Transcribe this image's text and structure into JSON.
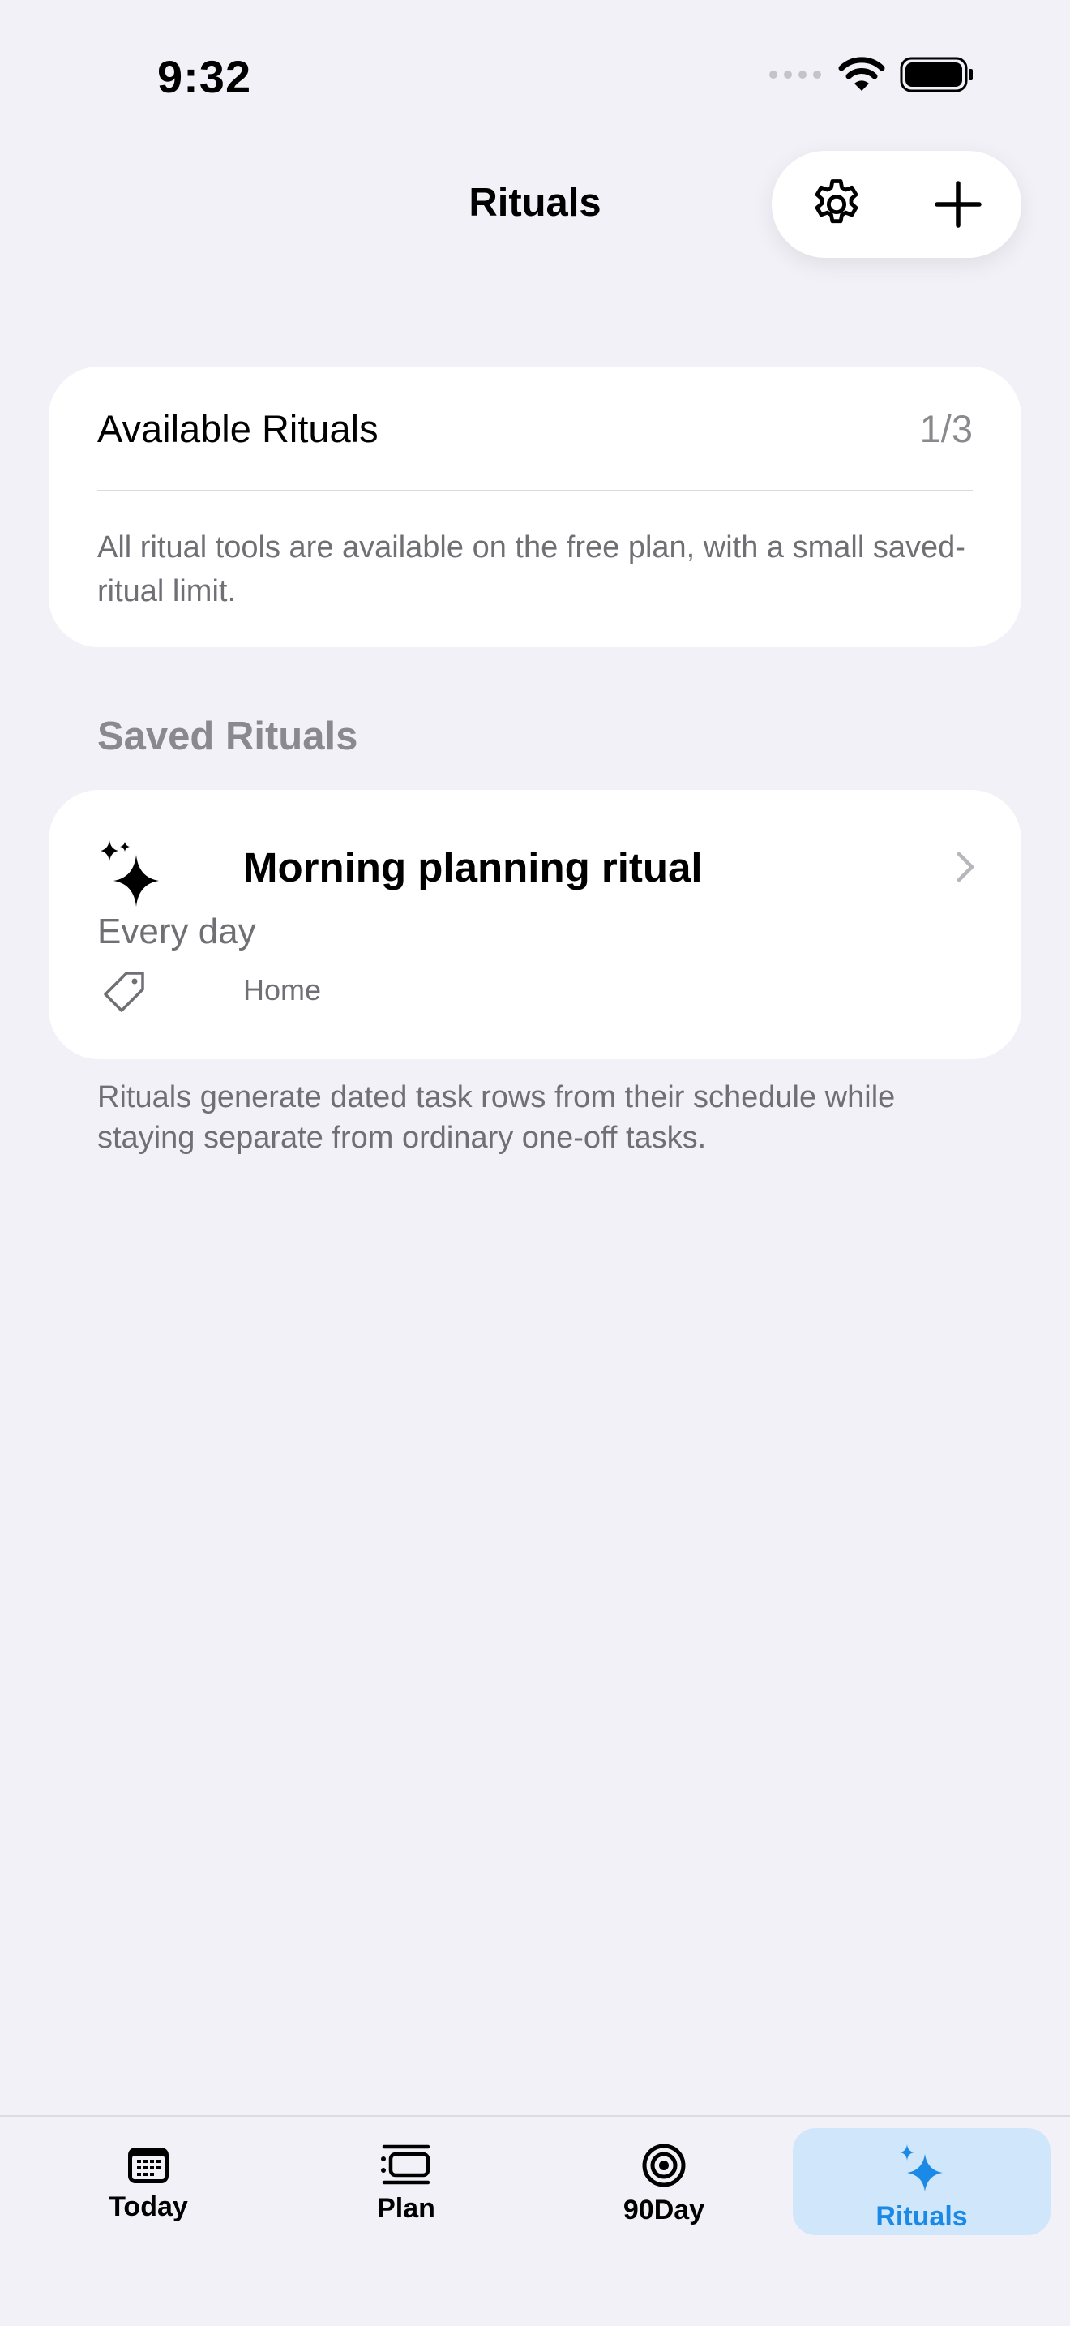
{
  "status_bar": {
    "time": "9:32"
  },
  "header": {
    "title": "Rituals",
    "settings_icon": "gear-icon",
    "add_icon": "plus-icon"
  },
  "available": {
    "title": "Available Rituals",
    "count": "1/3",
    "description": "All ritual tools are available on the free plan, with a small saved-ritual limit."
  },
  "saved_section": {
    "header": "Saved Rituals",
    "items": [
      {
        "title": "Morning planning ritual",
        "schedule": "Every day",
        "tag": "Home",
        "icon": "sparkles-icon"
      }
    ]
  },
  "footer_note": "Rituals generate dated task rows from their schedule while staying separate from ordinary one-off tasks.",
  "tabs": [
    {
      "label": "Today",
      "icon": "calendar-icon"
    },
    {
      "label": "Plan",
      "icon": "plan-list-icon"
    },
    {
      "label": "90Day",
      "icon": "target-icon"
    },
    {
      "label": "Rituals",
      "icon": "sparkles-icon",
      "active": true
    }
  ],
  "colors": {
    "accent": "#1a8ae6",
    "accent_bg": "#d0e6fb",
    "background": "#f2f1f7"
  }
}
